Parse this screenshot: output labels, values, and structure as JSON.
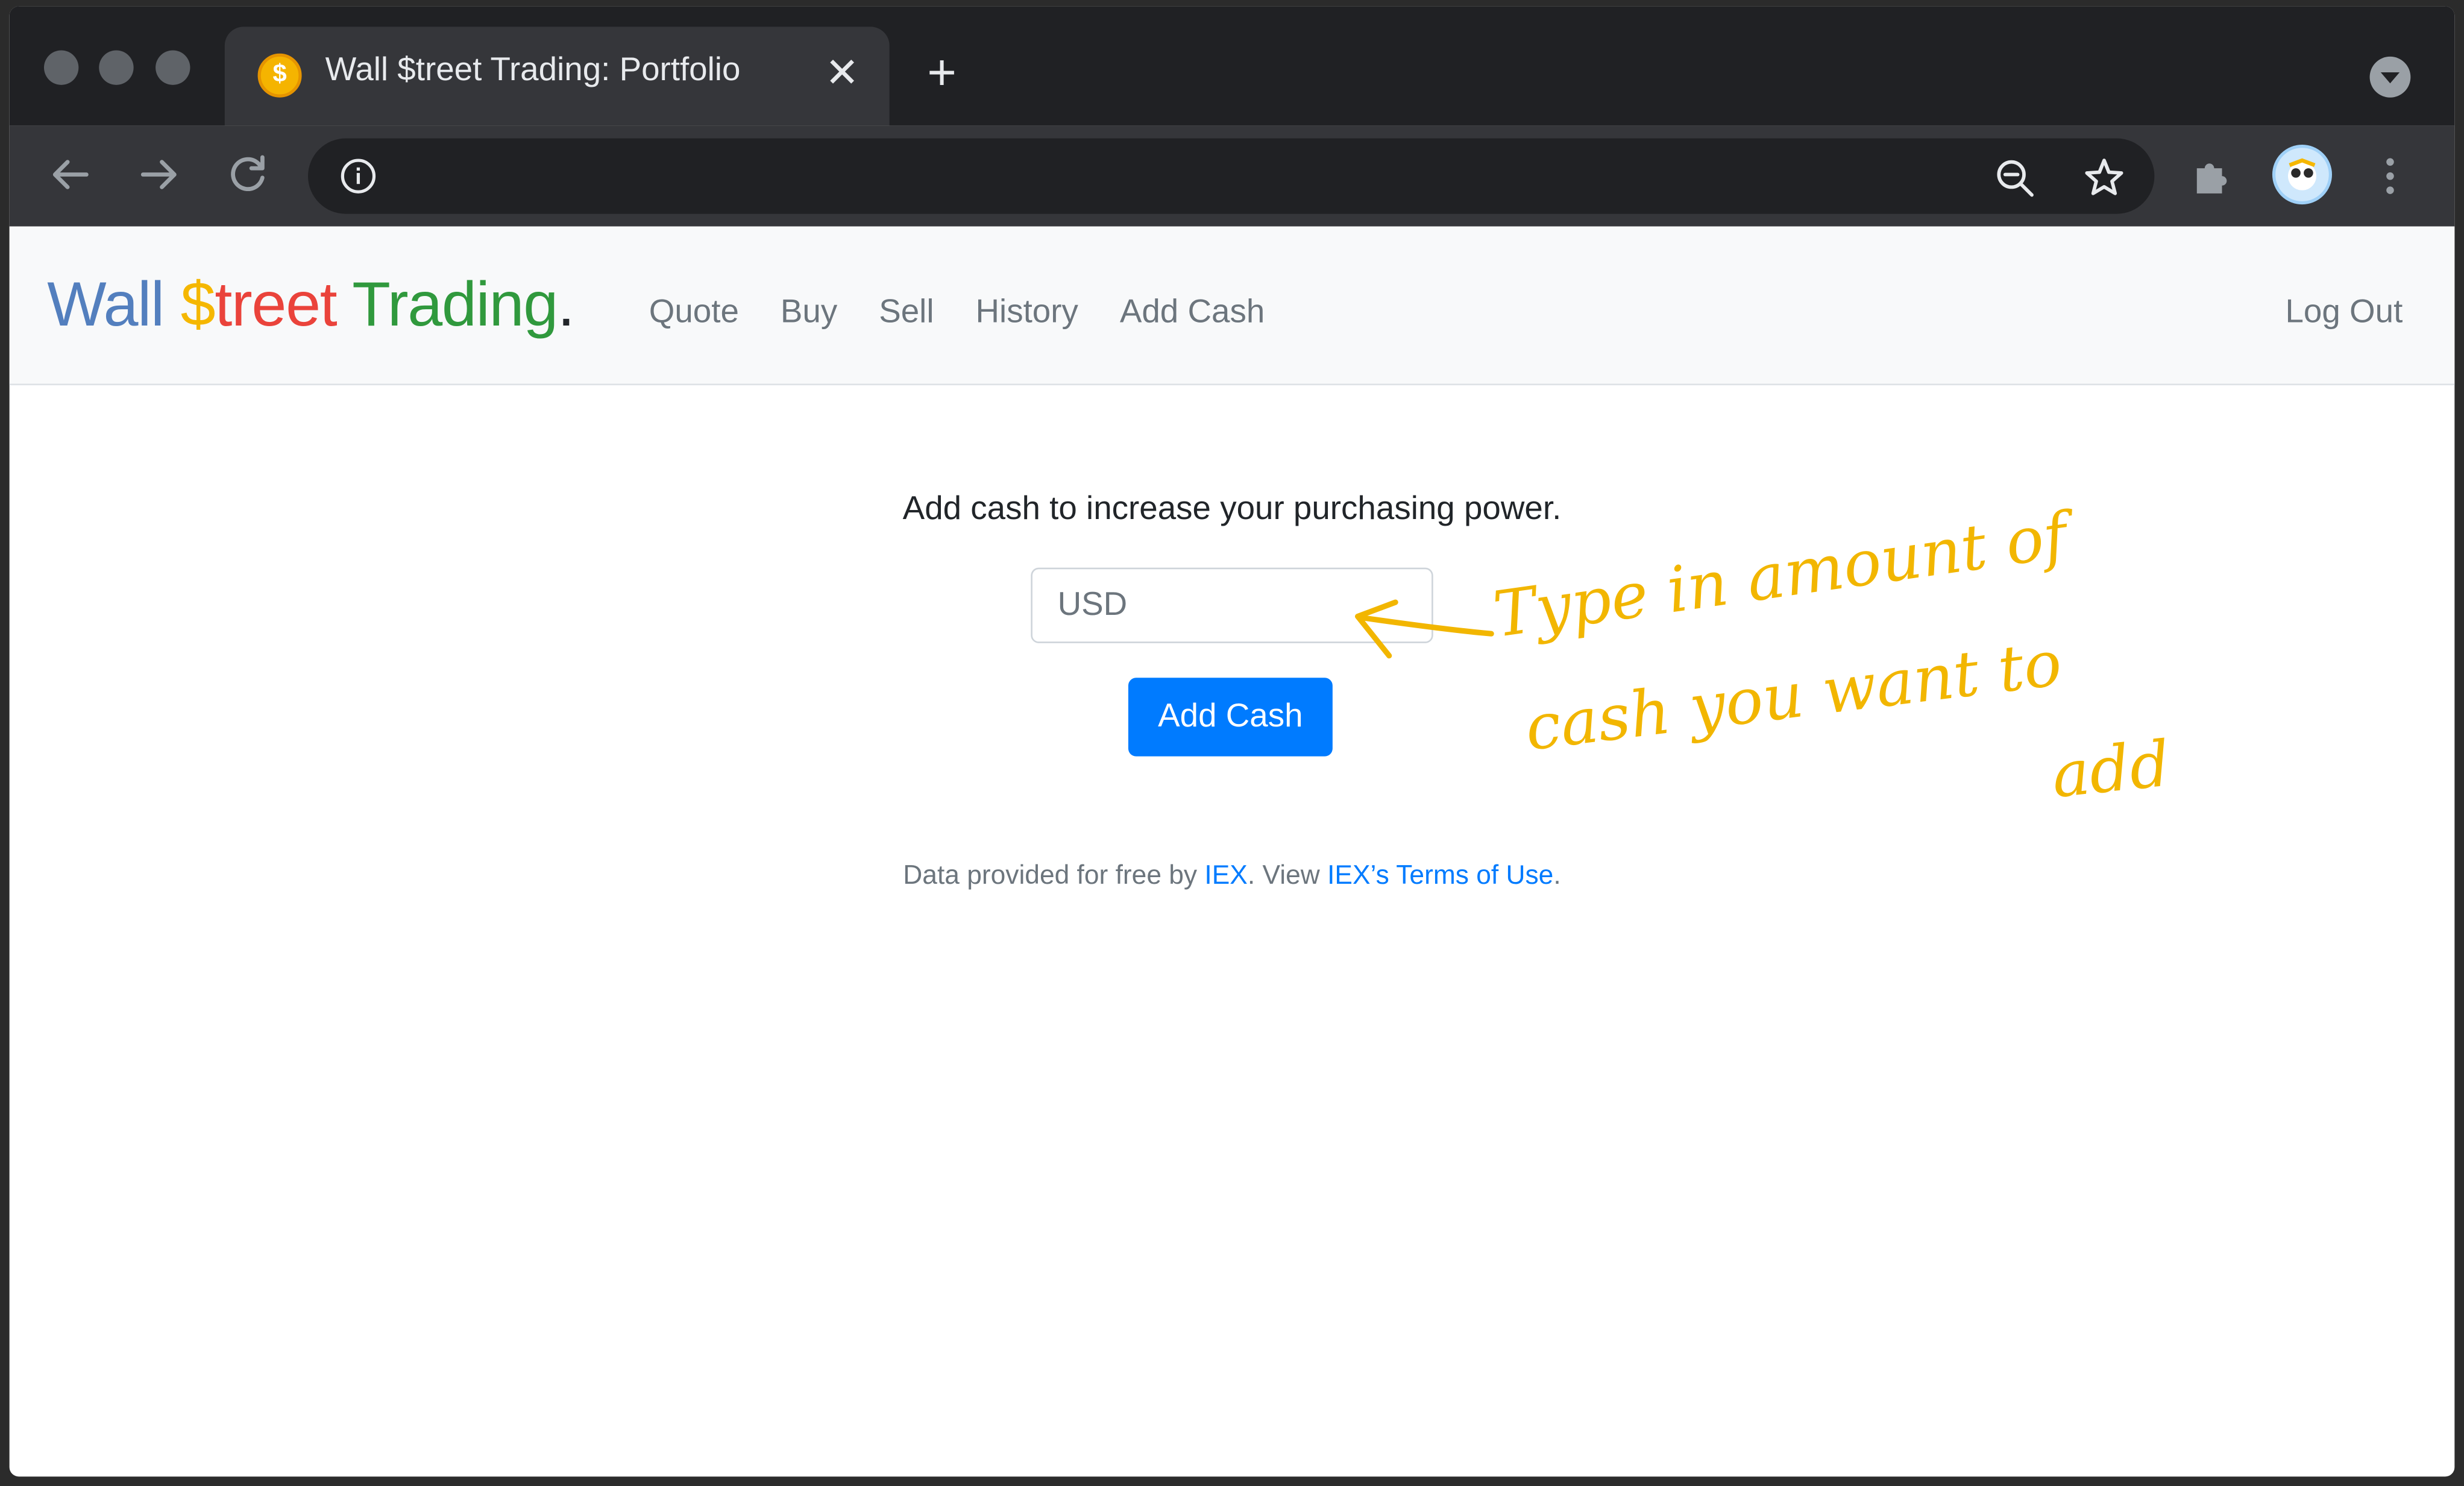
{
  "browser": {
    "tab": {
      "title": "Wall $treet Trading: Portfolio",
      "favicon_glyph": "$",
      "close_glyph": "✕"
    },
    "new_tab_glyph": "+",
    "icons": [
      "back-arrow-icon",
      "forward-arrow-icon",
      "reload-icon",
      "site-info-icon",
      "zoom-out-icon",
      "bookmark-star-icon",
      "extensions-puzzle-icon",
      "profile-avatar-icon",
      "more-menu-icon",
      "tab-search-icon"
    ]
  },
  "navbar": {
    "brand": {
      "part1": "Wall",
      "part2": "$",
      "part3": "treet",
      "part4": "Trading",
      "part5": "."
    },
    "links": [
      "Quote",
      "Buy",
      "Sell",
      "History",
      "Add Cash"
    ],
    "logout": "Log Out"
  },
  "main": {
    "intro": "Add cash to increase your purchasing power.",
    "input_placeholder": "USD",
    "button_label": "Add Cash"
  },
  "footer": {
    "text1": "Data provided for free by ",
    "link1": "IEX",
    "text2": ". View ",
    "link2": "IEX’s Terms of Use",
    "text3": "."
  },
  "annotation": {
    "line1": "Type in amount of",
    "line2": "cash you want to",
    "line3": "add"
  },
  "colors": {
    "brand_blue": "#537fbe",
    "brand_yellow": "#f5b700",
    "brand_red": "#ea433b",
    "brand_green": "#30993d",
    "primary_button": "#007bff",
    "annotation": "#f2b600"
  }
}
